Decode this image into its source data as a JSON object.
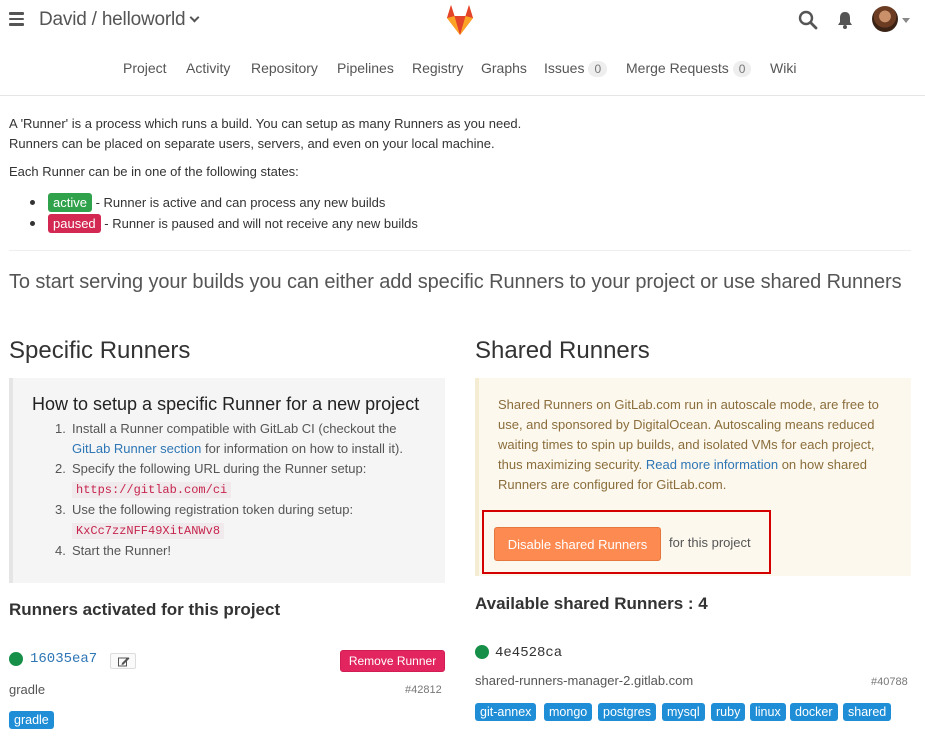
{
  "header": {
    "project_title": "David / helloworld"
  },
  "nav": {
    "items": [
      "Project",
      "Activity",
      "Repository",
      "Pipelines",
      "Registry",
      "Graphs",
      "Issues",
      "Merge Requests",
      "Wiki"
    ],
    "issues_count": "0",
    "mr_count": "0"
  },
  "intro": {
    "line1": "A 'Runner' is a process which runs a build. You can setup as many Runners as you need.",
    "line2": "Runners can be placed on separate users, servers, and even on your local machine.",
    "states_intro": "Each Runner can be in one of the following states:",
    "active_label": "active",
    "active_desc": " - Runner is active and can process any new builds",
    "paused_label": "paused",
    "paused_desc": " - Runner is paused and will not receive any new builds"
  },
  "lead": "To start serving your builds you can either add specific Runners to your project or use shared Runners",
  "specific": {
    "title": "Specific Runners",
    "setup_title": "How to setup a specific Runner for a new project",
    "step1_a": "Install a Runner compatible with GitLab CI (checkout the",
    "step1_link": "GitLab Runner section",
    "step1_b": " for information on how to install it).",
    "step2": "Specify the following URL during the Runner setup:",
    "url": "https://gitlab.com/ci",
    "step3": "Use the following registration token during setup:",
    "token": "KxCc7zzNFF49XitANWv8",
    "step4": "Start the Runner!",
    "activated_title": "Runners activated for this project",
    "runner": {
      "id": "16035ea7",
      "remove_label": "Remove Runner",
      "description": "gradle",
      "number": "#42812",
      "tag": "gradle"
    }
  },
  "shared": {
    "title": "Shared Runners",
    "text_a": "Shared Runners on GitLab.com run in autoscale mode, are free to use, and sponsored by DigitalOcean. Autoscaling means reduced waiting times to spin up builds, and isolated VMs for each project, thus maximizing security. ",
    "read_more": "Read more information",
    "text_b": " on how shared Runners are configured for GitLab.com.",
    "disable_button": "Disable shared Runners",
    "for_project": "for this project",
    "available_title": "Available shared Runners : 4",
    "runner": {
      "id": "4e4528ca",
      "description": "shared-runners-manager-2.gitlab.com",
      "number": "#40788",
      "tags": [
        "git-annex",
        "mongo",
        "postgres",
        "mysql",
        "ruby",
        "linux",
        "docker",
        "shared"
      ]
    }
  },
  "colors": {
    "active": "#31a24c",
    "paused": "#d22852",
    "disable_button": "#fc8a51",
    "remove_button": "#e2255f",
    "tag": "#1f8ed6",
    "online_dot": "#168f48"
  }
}
